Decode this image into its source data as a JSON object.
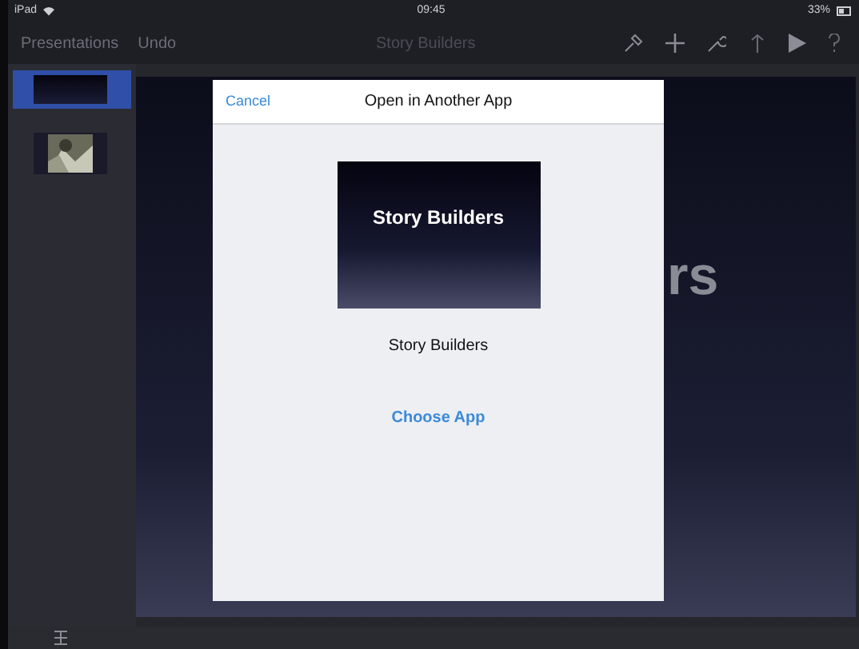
{
  "status_bar": {
    "device": "iPad",
    "time": "09:45",
    "battery": "33%"
  },
  "toolbar": {
    "buttons": [
      "Presentations",
      "Undo"
    ],
    "title": "Story Builders"
  },
  "slides": [
    {
      "kind": "title",
      "selected": true
    },
    {
      "kind": "picture",
      "selected": false
    }
  ],
  "canvas": {
    "visible_text": "rs"
  },
  "dialog": {
    "cancel": "Cancel",
    "title": "Open in Another App",
    "preview_title": "Story Builders",
    "file_name": "Story Builders",
    "action": "Choose App"
  }
}
